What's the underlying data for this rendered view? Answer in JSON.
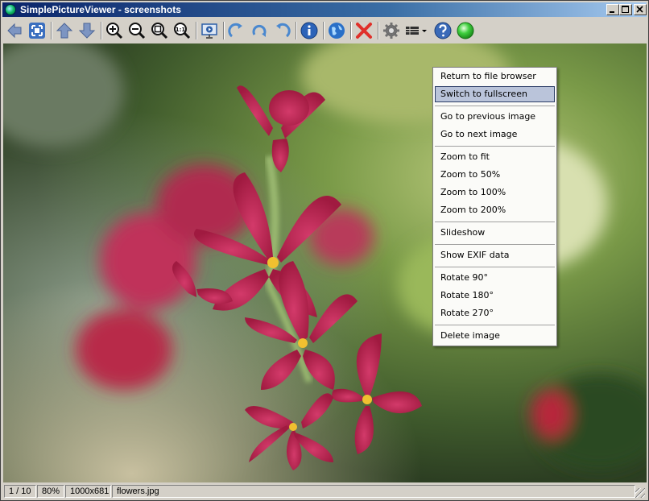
{
  "window": {
    "title": "SimplePictureViewer - screenshots",
    "caption_buttons": [
      "minimize",
      "maximize",
      "close"
    ]
  },
  "toolbar": {
    "buttons": [
      {
        "name": "back-arrow-icon",
        "color": "#6b86b8"
      },
      {
        "name": "fullscreen-icon",
        "color": "#3b6fbf"
      },
      {
        "name": "up-arrow-icon",
        "color": "#6b86b8"
      },
      {
        "name": "down-arrow-icon",
        "color": "#6b86b8"
      },
      {
        "name": "zoom-in-icon",
        "color": "#1a1a1a"
      },
      {
        "name": "zoom-out-icon",
        "color": "#1a1a1a"
      },
      {
        "name": "zoom-fit-icon",
        "color": "#1a1a1a"
      },
      {
        "name": "zoom-100-icon",
        "label": "1:1",
        "color": "#1a1a1a"
      },
      {
        "name": "slideshow-icon",
        "color": "#2d5fa8"
      },
      {
        "name": "rotate-90-icon",
        "color": "#3a7ec8"
      },
      {
        "name": "rotate-180-icon",
        "color": "#3a7ec8"
      },
      {
        "name": "rotate-270-icon",
        "color": "#3a7ec8"
      },
      {
        "name": "info-icon",
        "color": "#2c63b8"
      },
      {
        "name": "globe-icon",
        "color": "#2a70c8"
      },
      {
        "name": "delete-icon",
        "color": "#e0302a"
      },
      {
        "name": "settings-gear-icon",
        "color": "#707070"
      },
      {
        "name": "view-mode-icon",
        "color": "#303030"
      },
      {
        "name": "help-icon",
        "color": "#3a6ab8"
      },
      {
        "name": "status-green-icon",
        "color": "#3fcf3f"
      }
    ]
  },
  "status": {
    "position": "1 / 10",
    "zoom": "80%",
    "dimensions": "1000x681",
    "filename": "flowers.jpg"
  },
  "context_menu": {
    "groups": [
      [
        "Return to file browser",
        "Switch to fullscreen"
      ],
      [
        "Go to previous image",
        "Go to next image"
      ],
      [
        "Zoom to fit",
        "Zoom to 50%",
        "Zoom to 100%",
        "Zoom to 200%"
      ],
      [
        "Slideshow"
      ],
      [
        "Show EXIF data"
      ],
      [
        "Rotate 90°",
        "Rotate 180°",
        "Rotate 270°"
      ],
      [
        "Delete image"
      ]
    ],
    "highlighted": "Switch to fullscreen"
  },
  "colors": {
    "title_gradient_start": "#0a246a",
    "title_gradient_end": "#a6caf0",
    "menu_highlight": "#bac4da",
    "window_face": "#d4d0c8"
  }
}
